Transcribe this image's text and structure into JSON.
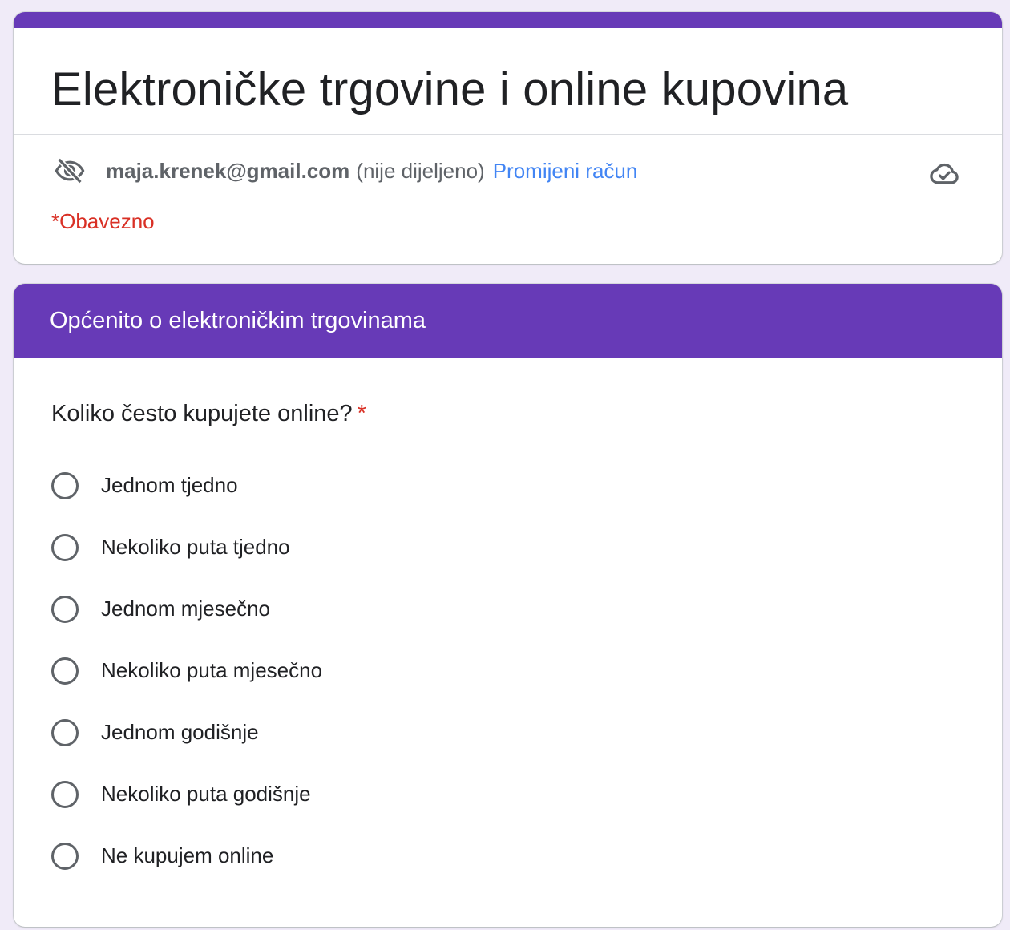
{
  "colors": {
    "accent": "#673ab7",
    "background": "#f0ebf8",
    "link": "#4285f4",
    "required": "#d93025"
  },
  "form": {
    "title": "Elektroničke trgovine i online kupovina",
    "account": {
      "icon": "eye-off-icon",
      "email": "maja.krenek@gmail.com",
      "note": "(nije dijeljeno)",
      "switch_label": "Promijeni račun",
      "cloud_icon": "cloud-check-icon"
    },
    "required_note": "*Obavezno"
  },
  "section": {
    "title": "Općenito o elektroničkim trgovinama"
  },
  "question": {
    "text": "Koliko često kupujete online?",
    "required_mark": "*",
    "options": [
      "Jednom tjedno",
      "Nekoliko puta tjedno",
      "Jednom mjesečno",
      "Nekoliko puta mjesečno",
      "Jednom godišnje",
      "Nekoliko puta godišnje",
      "Ne kupujem online"
    ]
  }
}
